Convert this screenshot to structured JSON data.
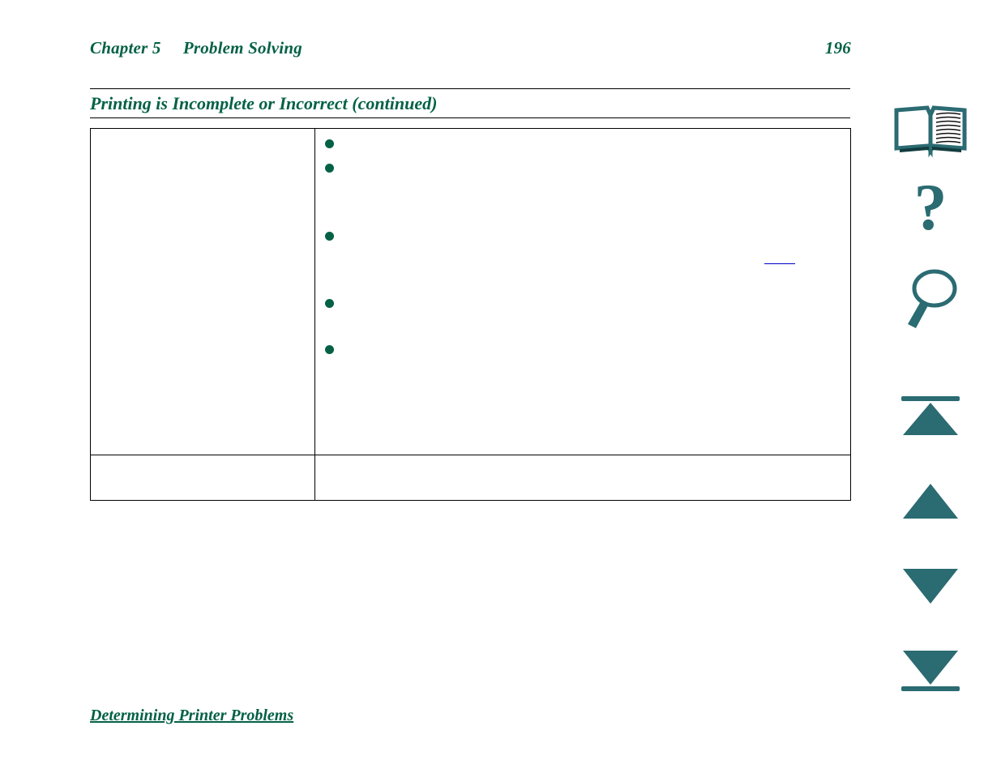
{
  "document": {
    "header": {
      "chapter_label": "Chapter 5     Problem Solving",
      "page_number": "196"
    },
    "section_heading": "Printing is Incomplete or Incorrect (continued)",
    "table": {
      "rows": [
        {
          "cause": "",
          "solution_bullets": [
            "",
            "",
            "",
            "",
            ""
          ],
          "cross_reference_link": ""
        },
        {
          "cause": "",
          "solution": ""
        }
      ]
    },
    "footer_link": "Determining Printer Problems"
  },
  "nav_sidebar": {
    "buttons": [
      {
        "name": "contents-icon",
        "label": "Contents"
      },
      {
        "name": "help-icon",
        "label": "Help"
      },
      {
        "name": "index-search-icon",
        "label": "Index"
      },
      {
        "name": "first-page-icon",
        "label": "First Page"
      },
      {
        "name": "previous-page-icon",
        "label": "Previous Page"
      },
      {
        "name": "next-page-icon",
        "label": "Next Page"
      },
      {
        "name": "last-page-icon",
        "label": "Last Page"
      }
    ]
  },
  "colors": {
    "heading_green": "#046145",
    "bullet_green": "#046145",
    "link_blue": "#0000cc",
    "icon_teal": "#2b6b72",
    "rule_black": "#000000"
  }
}
